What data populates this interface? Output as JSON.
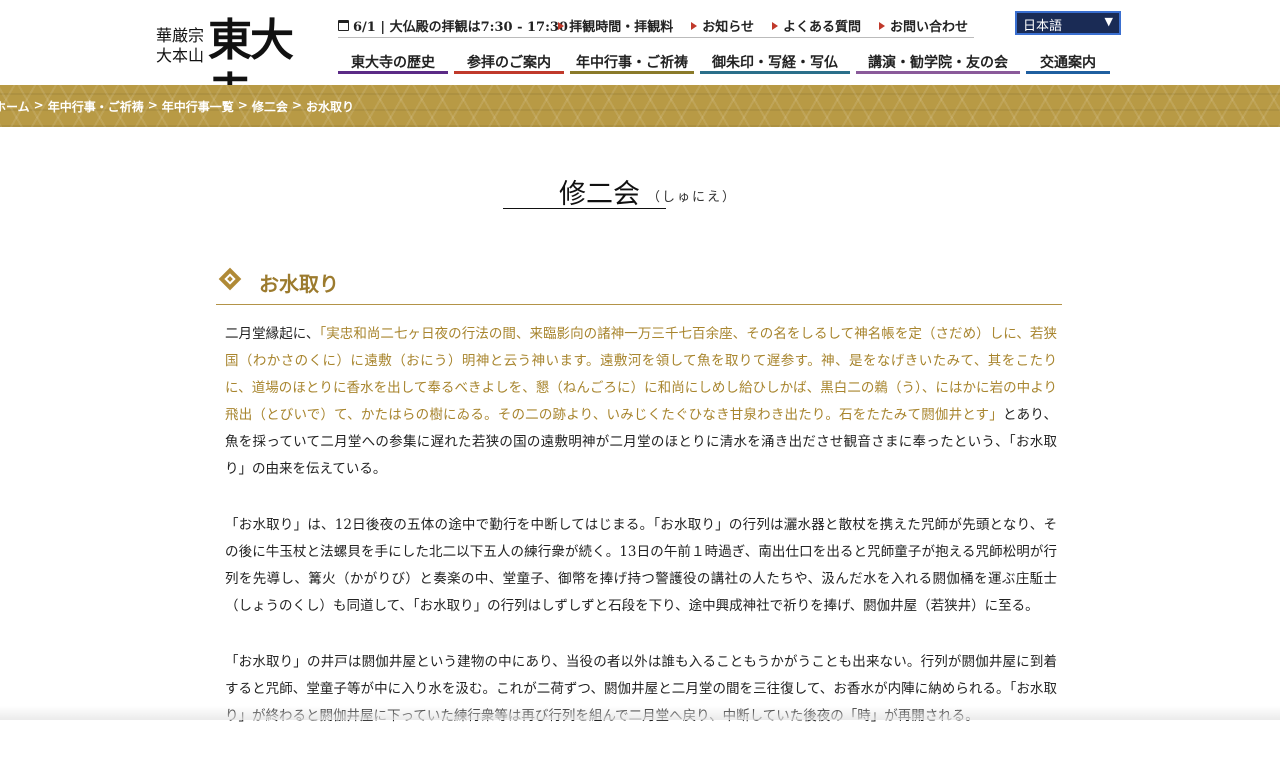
{
  "logo": {
    "sect_line1": "華厳宗",
    "sect_line2": "大本山",
    "mark": "東大寺"
  },
  "topbar": {
    "hours": "6/1 | 大仏殿の拝観は7:30 - 17:30",
    "links": [
      "拝観時間・拝観料",
      "お知らせ",
      "よくある質問",
      "お問い合わせ"
    ]
  },
  "language": {
    "selected": "日本語"
  },
  "nav": [
    {
      "label": "東大寺の歴史",
      "color": "#5b2a86"
    },
    {
      "label": "参拝のご案内",
      "color": "#c0392b"
    },
    {
      "label": "年中行事・ご祈祷",
      "color": "#8a7a2a"
    },
    {
      "label": "御朱印・写経・写仏",
      "color": "#2a6f8a"
    },
    {
      "label": "講演・勧学院・友の会",
      "color": "#8a5a9a"
    },
    {
      "label": "交通案内",
      "color": "#1f5fa0"
    }
  ],
  "breadcrumb": [
    "ホーム",
    "年中行事・ご祈祷",
    "年中行事一覧",
    "修二会",
    "お水取り"
  ],
  "page": {
    "title": "修二会",
    "ruby": "（しゅにえ）"
  },
  "section": {
    "title": "お水取り"
  },
  "paragraphs": {
    "p1_intro": "二月堂縁起に、",
    "p1_quote": "「実忠和尚二七ヶ日夜の行法の間、来臨影向の諸神一万三千七百余座、その名をしるして神名帳を定（さだめ）しに、若狭国（わかさのくに）に遠敷（おにう）明神と云う神います。遠敷河を領して魚を取りて遅参す。神、是をなげきいたみて、其をこたりに、道場のほとりに香水を出して奉るべきよしを、懇（ねんごろに）に和尚にしめし給ひしかば、黒白二の鵜（う）、にはかに岩の中より飛出（とびいで）て、かたはらの樹にゐる。その二の跡より、いみじくたぐひなき甘泉わき出たり。石をたたみて閼伽井とす」",
    "p1_rest": "とあり、魚を採っていて二月堂への参集に遅れた若狭の国の遠敷明神が二月堂のほとりに清水を涌き出ださせ観音さまに奉ったという、「お水取り」の由来を伝えている。",
    "p2": "「お水取り」は、12日後夜の五体の途中で勤行を中断してはじまる。「お水取り」の行列は灑水器と散杖を携えた咒師が先頭となり、その後に牛玉杖と法螺貝を手にした北二以下五人の練行衆が続く。13日の午前１時過ぎ、南出仕口を出ると咒師童子が抱える咒師松明が行列を先導し、篝火（かがりび）と奏楽の中、堂童子、御幣を捧げ持つ警護役の講社の人たちや、汲んだ水を入れる閼伽桶を運ぶ庄駈士（しょうのくし）も同道して、「お水取り」の行列はしずしずと石段を下り、途中興成神社で祈りを捧げ、閼伽井屋（若狭井）に至る。",
    "p3": "「お水取り」の井戸は閼伽井屋という建物の中にあり、当役の者以外は誰も入ることもうかがうことも出来ない。行列が閼伽井屋に到着すると咒師、堂童子等が中に入り水を汲む。これが二荷ずつ、閼伽井屋と二月堂の間を三往復して、お香水が内陣に納められる。「お水取り」が終わると閼伽井屋に下っていた練行衆等は再び行列を組んで二月堂へ戻り、中断していた後夜の「時」が再開される。"
  }
}
